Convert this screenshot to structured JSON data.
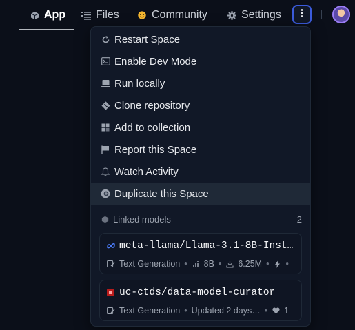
{
  "tabs": [
    {
      "label": "App",
      "icon": "cube-icon",
      "active": true
    },
    {
      "label": "Files",
      "icon": "files-icon",
      "active": false
    },
    {
      "label": "Community",
      "icon": "community-icon",
      "active": false
    },
    {
      "label": "Settings",
      "icon": "gear-icon",
      "active": false
    }
  ],
  "menu": {
    "items": [
      {
        "label": "Restart Space",
        "icon": "restart-icon"
      },
      {
        "label": "Enable Dev Mode",
        "icon": "terminal-icon"
      },
      {
        "label": "Run locally",
        "icon": "laptop-icon"
      },
      {
        "label": "Clone repository",
        "icon": "git-icon"
      },
      {
        "label": "Add to collection",
        "icon": "collection-icon"
      },
      {
        "label": "Report this Space",
        "icon": "flag-icon"
      },
      {
        "label": "Watch Activity",
        "icon": "bell-icon"
      },
      {
        "label": "Duplicate this Space",
        "icon": "duplicate-icon",
        "hovered": true
      }
    ],
    "linked_models": {
      "title": "Linked models",
      "count": "2",
      "models": [
        {
          "name": "meta-llama/Llama-3.1-8B-Instr…",
          "task": "Text Generation",
          "params": "8B",
          "downloads": "6.25M",
          "logo": "meta-logo-icon"
        },
        {
          "name": "uc-ctds/data-model-curator",
          "task": "Text Generation",
          "updated": "Updated 2 days…",
          "likes": "1",
          "logo": "uc-logo-icon"
        }
      ]
    }
  },
  "colors": {
    "background": "#0b0f19",
    "menu_bg": "#111827",
    "accent_border": "#3b5bdb",
    "avatar_border": "#9b7df5"
  }
}
